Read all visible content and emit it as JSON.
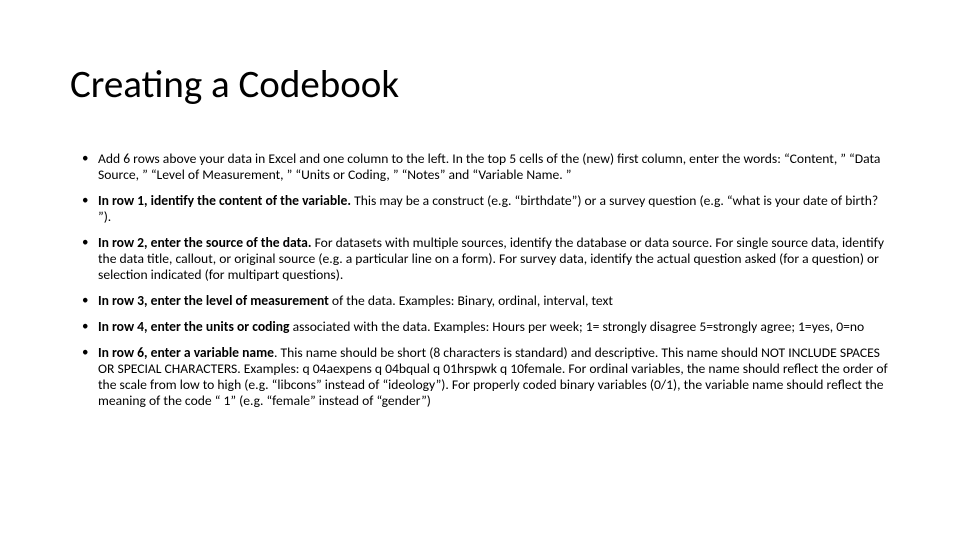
{
  "title": "Creating a Codebook",
  "bullets": [
    {
      "html": "Add 6 rows above your data in Excel and one column to the left. In the top 5 cells of the (new) first column, enter the words: “Content, ” “Data Source, ” “Level of Measurement, ” “Units or Coding, ” “Notes” and “Variable Name. ”"
    },
    {
      "html": "<b>In row 1, identify the content of the variable.</b> This may be a construct (e.g. “birthdate”) or a survey question (e.g. “what is your date of birth? ”)."
    },
    {
      "html": "<b>In row 2, enter the source of the data.</b> For datasets with multiple sources, identify the database or data source. For single source data, identify the data title, callout, or original source (e.g. a particular line on a form). For survey data, identify the actual question asked (for a question) or selection indicated (for multipart questions)."
    },
    {
      "html": "<b>In row 3, enter the level of measurement</b> of the data. Examples: Binary, ordinal, interval, text"
    },
    {
      "html": "<b>In row 4, enter the units or coding</b> associated with the data. Examples: Hours per week; 1= strongly disagree 5=strongly agree; 1=yes, 0=no"
    },
    {
      "html": "<b>In row 6, enter a variable name</b>. This name should be short (8 characters is standard) and descriptive. This name should NOT INCLUDE SPACES OR SPECIAL CHARACTERS. Examples: q 04aexpens q 04bqual q 01hrspwk q 10female. For ordinal variables, the name should reflect the order of the scale from low to high (e.g. “libcons” instead of “ideology”). For properly coded binary variables (0/1), the variable name should reflect the meaning of the code “ 1” (e.g. “female” instead of “gender”)"
    }
  ]
}
